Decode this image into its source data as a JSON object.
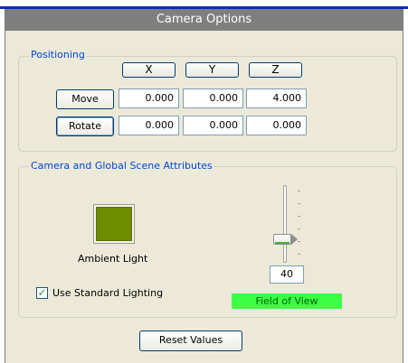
{
  "window": {
    "title": "Camera Options"
  },
  "positioning": {
    "title": "Positioning",
    "axes": [
      "X",
      "Y",
      "Z"
    ],
    "rows": [
      {
        "label": "Move",
        "values": [
          "0.000",
          "0.000",
          "4.000"
        ]
      },
      {
        "label": "Rotate",
        "values": [
          "0.000",
          "0.000",
          "0.000"
        ]
      }
    ]
  },
  "scene": {
    "title": "Camera and Global Scene Attributes",
    "ambient_label": "Ambient Light",
    "ambient_color": "#6f8c00",
    "use_standard_lighting_label": "Use Standard Lighting",
    "use_standard_lighting": true,
    "field_of_view_value": "40",
    "field_of_view_label": "Field of View",
    "field_of_view_color": "#3cff46"
  },
  "footer": {
    "reset_label": "Reset Values"
  }
}
